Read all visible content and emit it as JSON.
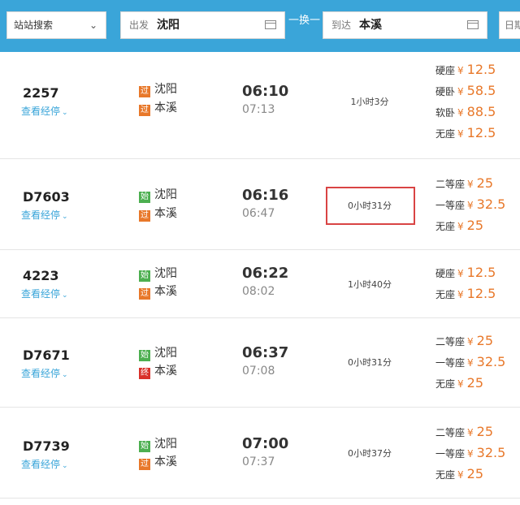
{
  "search": {
    "mode_select": "站站搜索",
    "from_label": "出发",
    "from_value": "沈阳",
    "swap_label": "一换一",
    "to_label": "到达",
    "to_value": "本溪",
    "date_label": "日期"
  },
  "via_label": "查看经停",
  "trains": [
    {
      "number": "2257",
      "from_tag": "过",
      "from_tag_type": "pass",
      "from_station": "沈阳",
      "to_tag": "过",
      "to_tag_type": "pass",
      "to_station": "本溪",
      "depart": "06:10",
      "arrive": "07:13",
      "duration": "1小时3分",
      "seats": [
        {
          "name": "硬座",
          "currency": "¥",
          "price": "12.5"
        },
        {
          "name": "硬卧",
          "currency": "¥",
          "price": "58.5"
        },
        {
          "name": "软卧",
          "currency": "¥",
          "price": "88.5"
        },
        {
          "name": "无座",
          "currency": "¥",
          "price": "12.5"
        }
      ]
    },
    {
      "number": "D7603",
      "from_tag": "始",
      "from_tag_type": "start",
      "from_station": "沈阳",
      "to_tag": "过",
      "to_tag_type": "pass",
      "to_station": "本溪",
      "depart": "06:16",
      "arrive": "06:47",
      "duration": "0小时31分",
      "highlighted": true,
      "seats": [
        {
          "name": "二等座",
          "currency": "¥",
          "price": "25"
        },
        {
          "name": "一等座",
          "currency": "¥",
          "price": "32.5"
        },
        {
          "name": "无座",
          "currency": "¥",
          "price": "25"
        }
      ]
    },
    {
      "number": "4223",
      "from_tag": "始",
      "from_tag_type": "start",
      "from_station": "沈阳",
      "to_tag": "过",
      "to_tag_type": "pass",
      "to_station": "本溪",
      "depart": "06:22",
      "arrive": "08:02",
      "duration": "1小时40分",
      "seats": [
        {
          "name": "硬座",
          "currency": "¥",
          "price": "12.5"
        },
        {
          "name": "无座",
          "currency": "¥",
          "price": "12.5"
        }
      ]
    },
    {
      "number": "D7671",
      "from_tag": "始",
      "from_tag_type": "start",
      "from_station": "沈阳",
      "to_tag": "终",
      "to_tag_type": "end",
      "to_station": "本溪",
      "depart": "06:37",
      "arrive": "07:08",
      "duration": "0小时31分",
      "seats": [
        {
          "name": "二等座",
          "currency": "¥",
          "price": "25"
        },
        {
          "name": "一等座",
          "currency": "¥",
          "price": "32.5"
        },
        {
          "name": "无座",
          "currency": "¥",
          "price": "25"
        }
      ]
    },
    {
      "number": "D7739",
      "from_tag": "始",
      "from_tag_type": "start",
      "from_station": "沈阳",
      "to_tag": "过",
      "to_tag_type": "pass",
      "to_station": "本溪",
      "depart": "07:00",
      "arrive": "07:37",
      "duration": "0小时37分",
      "seats": [
        {
          "name": "二等座",
          "currency": "¥",
          "price": "25"
        },
        {
          "name": "一等座",
          "currency": "¥",
          "price": "32.5"
        },
        {
          "name": "无座",
          "currency": "¥",
          "price": "25"
        }
      ]
    }
  ],
  "colors": {
    "header_bar": "#3aa5d9",
    "price": "#e8782a",
    "tag_pass": "#e8782a",
    "tag_start": "#4caf50",
    "tag_end": "#d9312a",
    "highlight_box": "#d94444"
  }
}
